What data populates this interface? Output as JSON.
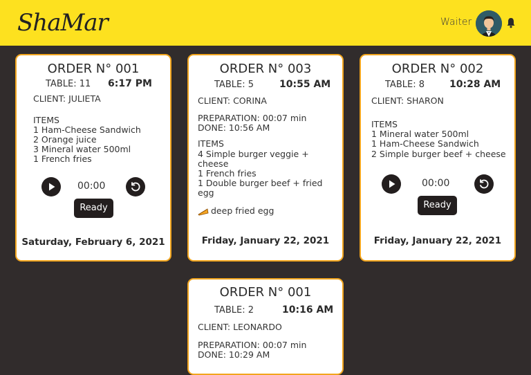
{
  "header": {
    "logo": "ShaMar",
    "role": "Waiter"
  },
  "orders": [
    {
      "title": "ORDER N° 001",
      "table": "TABLE: 11",
      "time": "6:17 PM",
      "client": "CLIENT: JULIETA",
      "items_label": "ITEMS",
      "items": [
        "1 Ham-Cheese Sandwich",
        "2 Orange juice",
        "3 Mineral water 500ml",
        "1 French fries"
      ],
      "timer": "00:00",
      "ready_label": "Ready",
      "date": "Saturday, February 6, 2021"
    },
    {
      "title": "ORDER N° 003",
      "table": "TABLE: 5",
      "time": "10:55 AM",
      "client": "CLIENT: CORINA",
      "preparation": "PREPARATION: 00:07 min",
      "done": "DONE: 10:56 AM",
      "items_label": "ITEMS",
      "items": [
        "4 Simple burger veggie + cheese",
        "1 French fries",
        "1 Double burger beef + fried egg"
      ],
      "note": "deep fried egg",
      "date": "Friday, January 22, 2021"
    },
    {
      "title": "ORDER N° 002",
      "table": "TABLE: 8",
      "time": "10:28 AM",
      "client": "CLIENT: SHARON",
      "items_label": "ITEMS",
      "items": [
        "1 Mineral water 500ml",
        "1 Ham-Cheese Sandwich",
        "2 Simple burger beef + cheese"
      ],
      "timer": "00:00",
      "ready_label": "Ready",
      "date": "Friday, January 22, 2021"
    },
    {
      "title": "ORDER N° 001",
      "table": "TABLE: 2",
      "time": "10:16 AM",
      "client": "CLIENT: LEONARDO",
      "preparation": "PREPARATION: 00:07 min",
      "done": "DONE: 10:29 AM"
    }
  ]
}
